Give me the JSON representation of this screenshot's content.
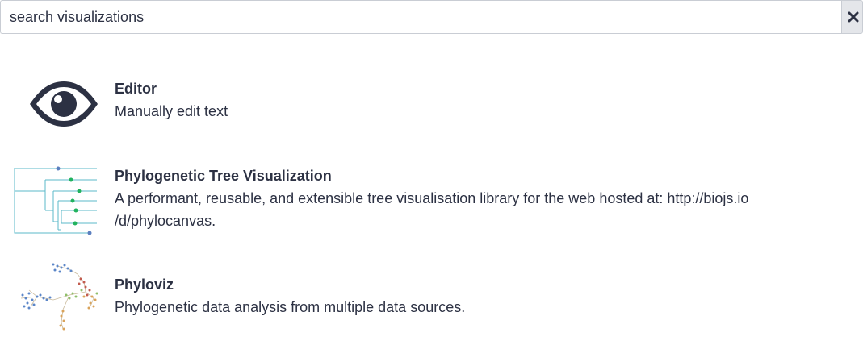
{
  "search": {
    "placeholder": "search visualizations",
    "value": ""
  },
  "items": [
    {
      "title": "Editor",
      "description": "Manually edit text",
      "icon": "eye-icon"
    },
    {
      "title": "Phylogenetic Tree Visualization",
      "description": "A performant, reusable, and extensible tree visualisation library for the web hosted at: http://biojs.io /d/phylocanvas.",
      "icon": "phylogenetic-tree-thumbnail"
    },
    {
      "title": "Phyloviz",
      "description": "Phylogenetic data analysis from multiple data sources.",
      "icon": "phyloviz-thumbnail"
    }
  ],
  "colors": {
    "text": "#2c3143",
    "clear_button_bg": "#e4e6ea",
    "tree_line": "#5bb8c9",
    "tree_node": "#22b35e"
  }
}
